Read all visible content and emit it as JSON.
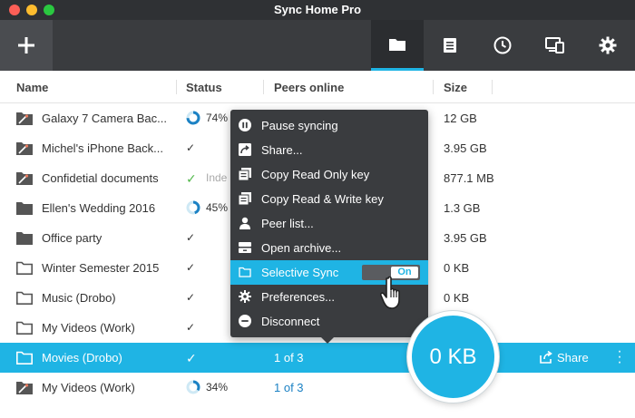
{
  "window": {
    "title": "Sync Home Pro"
  },
  "toolbar": {
    "add_icon": "plus-icon",
    "tools": [
      "folder-icon",
      "document-icon",
      "clock-icon",
      "devices-icon",
      "gear-icon"
    ],
    "active_tool": "folder-icon"
  },
  "columns": {
    "name": "Name",
    "status": "Status",
    "peers": "Peers online",
    "size": "Size"
  },
  "rows": [
    {
      "name": "Galaxy 7 Camera Bac...",
      "icon": "device-folder-icon",
      "status": "74%",
      "status_type": "progress",
      "progress": 0.74,
      "size": "12 GB"
    },
    {
      "name": "Michel's iPhone Back...",
      "icon": "device-folder-icon",
      "status": "✓",
      "status_type": "check",
      "size": "3.95 GB"
    },
    {
      "name": "Confidetial documents",
      "icon": "device-folder-icon",
      "status": "Inde",
      "status_type": "check-text",
      "size": "877.1 MB"
    },
    {
      "name": "Ellen's Wedding 2016",
      "icon": "folder-icon",
      "status": "45%",
      "status_type": "progress",
      "progress": 0.45,
      "size": "1.3 GB"
    },
    {
      "name": "Office party",
      "icon": "folder-icon",
      "status": "✓",
      "status_type": "check",
      "size": "3.95 GB"
    },
    {
      "name": "Winter Semester 2015",
      "icon": "folder-outline-icon",
      "status": "✓",
      "status_type": "check",
      "size": "0 KB"
    },
    {
      "name": "Music (Drobo)",
      "icon": "folder-outline-icon",
      "status": "✓",
      "status_type": "check",
      "size": "0 KB"
    },
    {
      "name": "My Videos (Work)",
      "icon": "folder-outline-icon",
      "status": "✓",
      "status_type": "check",
      "size": ""
    },
    {
      "name": "Movies (Drobo)",
      "icon": "folder-outline-icon",
      "status": "✓",
      "status_type": "check",
      "peers": "1 of 3",
      "size": "",
      "share": "Share",
      "selected": true
    },
    {
      "name": "My Videos (Work)",
      "icon": "device-folder-icon",
      "status": "34%",
      "status_type": "progress",
      "progress": 0.34,
      "peers": "1 of 3",
      "size": ""
    }
  ],
  "context_menu": {
    "items": [
      {
        "label": "Pause syncing",
        "icon": "pause-icon"
      },
      {
        "label": "Share...",
        "icon": "share-icon"
      },
      {
        "label": "Copy Read Only key",
        "icon": "copy-icon"
      },
      {
        "label": "Copy Read & Write key",
        "icon": "copy-icon"
      },
      {
        "label": "Peer list...",
        "icon": "user-icon"
      },
      {
        "label": "Open archive...",
        "icon": "archive-icon"
      },
      {
        "label": "Selective Sync",
        "icon": "folder-outline-icon",
        "highlighted": true,
        "toggle": "On"
      },
      {
        "label": "Preferences...",
        "icon": "gear-icon"
      },
      {
        "label": "Disconnect",
        "icon": "minus-circle-icon"
      }
    ]
  },
  "magnifier": {
    "value": "0 KB"
  },
  "colors": {
    "accent": "#1fb4e4",
    "toolbar": "#3a3c3f",
    "check": "#52b84b",
    "link": "#1c82c4"
  }
}
